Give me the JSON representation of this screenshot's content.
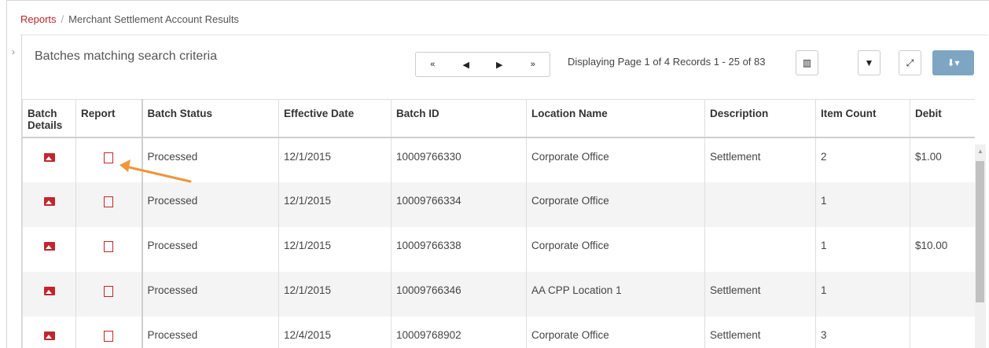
{
  "breadcrumb": {
    "root": "Reports",
    "separator": "/",
    "current": "Merchant Settlement Account Results"
  },
  "panel": {
    "title": "Batches matching search criteria",
    "toggle_icon": "chevron-right-icon"
  },
  "pager": {
    "first_icon": "«",
    "prev_icon": "◀",
    "next_icon": "▶",
    "last_icon": "»",
    "info": "Displaying Page 1 of 4 Records 1 - 25 of 83"
  },
  "toolbar": {
    "columns_icon": "▥",
    "filter_icon": "▼",
    "expand_icon": "⤢",
    "export_icon": "⬇▾"
  },
  "table": {
    "headers": [
      "Batch Details",
      "Report",
      "Batch Status",
      "Effective Date",
      "Batch ID",
      "Location Name",
      "Description",
      "Item Count",
      "Debit"
    ],
    "header_lines": {
      "batch_details_1": "Batch",
      "batch_details_2": "Details"
    },
    "rows": [
      {
        "status": "Processed",
        "date": "12/1/2015",
        "batch_id": "10009766330",
        "location": "Corporate Office",
        "description": "Settlement",
        "item_count": "2",
        "debit": "$1.00"
      },
      {
        "status": "Processed",
        "date": "12/1/2015",
        "batch_id": "10009766334",
        "location": "Corporate Office",
        "description": "",
        "item_count": "1",
        "debit": ""
      },
      {
        "status": "Processed",
        "date": "12/1/2015",
        "batch_id": "10009766338",
        "location": "Corporate Office",
        "description": "",
        "item_count": "1",
        "debit": "$10.00"
      },
      {
        "status": "Processed",
        "date": "12/1/2015",
        "batch_id": "10009766346",
        "location": "AA CPP Location 1",
        "description": "Settlement",
        "item_count": "1",
        "debit": ""
      },
      {
        "status": "Processed",
        "date": "12/4/2015",
        "batch_id": "10009768902",
        "location": "Corporate Office",
        "description": "Settlement",
        "item_count": "3",
        "debit": ""
      }
    ]
  },
  "colors": {
    "accent": "#b5262b",
    "arrow": "#f0953a",
    "export_button": "#7ea6c3"
  }
}
